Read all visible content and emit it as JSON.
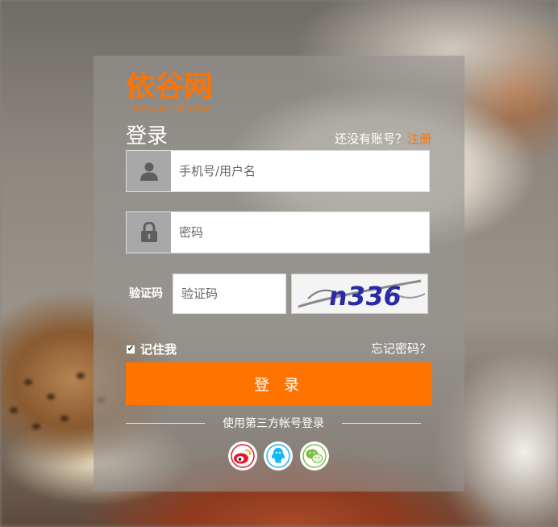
{
  "logo": {
    "main": "依谷网",
    "sub": "农产品旗下购物网站"
  },
  "title": "登录",
  "register": {
    "prompt": "还没有账号？",
    "link": "注册"
  },
  "username": {
    "placeholder": "手机号/用户名",
    "icon": "user-icon"
  },
  "password": {
    "placeholder": "密码",
    "icon": "lock-icon"
  },
  "captcha": {
    "label": "验证码",
    "placeholder": "验证码",
    "image_text": "n336"
  },
  "remember": {
    "label": "记住我",
    "checked": true
  },
  "forgot": "忘记密码？",
  "login_button": "登 录",
  "third_party": {
    "label": "使用第三方帐号登录",
    "providers": [
      "weibo-icon",
      "qq-icon",
      "wechat-icon"
    ]
  },
  "colors": {
    "accent": "#ff7300",
    "weibo": "#e6162d",
    "qq": "#12b7f5",
    "wechat": "#7bc043"
  }
}
